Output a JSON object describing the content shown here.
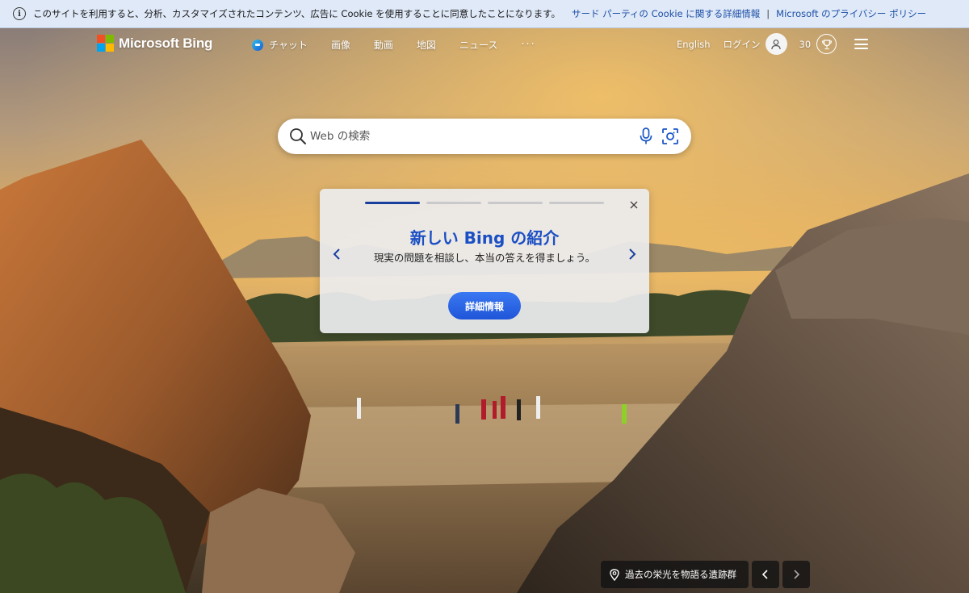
{
  "cookie_bar": {
    "message": "このサイトを利用すると、分析、カスタマイズされたコンテンツ、広告に Cookie を使用することに同意したことになります。",
    "link_third_party": "サード パーティの Cookie に関する詳細情報",
    "separator": "|",
    "link_privacy": "Microsoft のプライバシー ポリシー"
  },
  "header": {
    "brand": "Microsoft Bing",
    "nav": {
      "chat": "チャット",
      "images": "画像",
      "videos": "動画",
      "maps": "地図",
      "news": "ニュース",
      "more": "···"
    },
    "language": "English",
    "login": "ログイン",
    "points": "30"
  },
  "search": {
    "placeholder": "Web の検索"
  },
  "promo": {
    "title": "新しい Bing の紹介",
    "body": "現実の問題を相談し、本当の答えを得ましょう。",
    "button": "詳細情報",
    "total_slides": 4,
    "active_slide": 1
  },
  "image_caption": {
    "text": "過去の栄光を物語る遺跡群"
  },
  "colors": {
    "accent": "#1b4fc4",
    "cookie_bg": "#dfe9f8",
    "button": "#2a64e6"
  }
}
